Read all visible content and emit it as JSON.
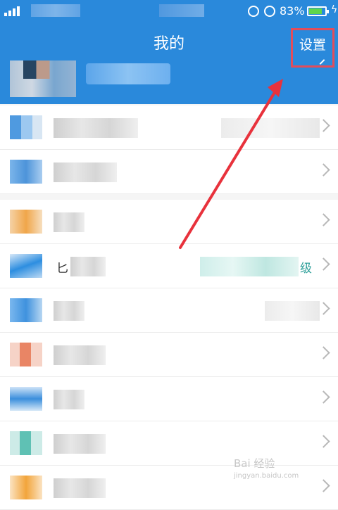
{
  "status_bar": {
    "battery_percent": "83%",
    "battery_level": 0.83,
    "icons": [
      "signal-icon",
      "lock-rotation-icon",
      "alarm-icon",
      "battery-icon",
      "charging-icon"
    ]
  },
  "header": {
    "title": "我的",
    "settings_label": "设置",
    "background": "#2a89db"
  },
  "annotation": {
    "highlight_color": "#e24d5b",
    "arrow_color": "#e8323c"
  },
  "list_groups": [
    {
      "items": [
        {
          "icon": "app-icon-1",
          "label": "",
          "value": ""
        },
        {
          "icon": "app-icon-2",
          "label": "",
          "value": ""
        }
      ]
    },
    {
      "items": [
        {
          "icon": "app-icon-3",
          "label": "",
          "value": ""
        },
        {
          "icon": "app-icon-4",
          "label": "匕",
          "value": "级"
        },
        {
          "icon": "app-icon-5",
          "label": "",
          "value": ""
        },
        {
          "icon": "app-icon-6",
          "label": "",
          "value": ""
        },
        {
          "icon": "app-icon-7",
          "label": "",
          "value": ""
        },
        {
          "icon": "app-icon-8",
          "label": "",
          "value": ""
        },
        {
          "icon": "app-icon-9",
          "label": "",
          "value": ""
        }
      ]
    }
  ],
  "watermark": {
    "text": "Bai 经验",
    "sub": "jingyan.baidu.com"
  }
}
